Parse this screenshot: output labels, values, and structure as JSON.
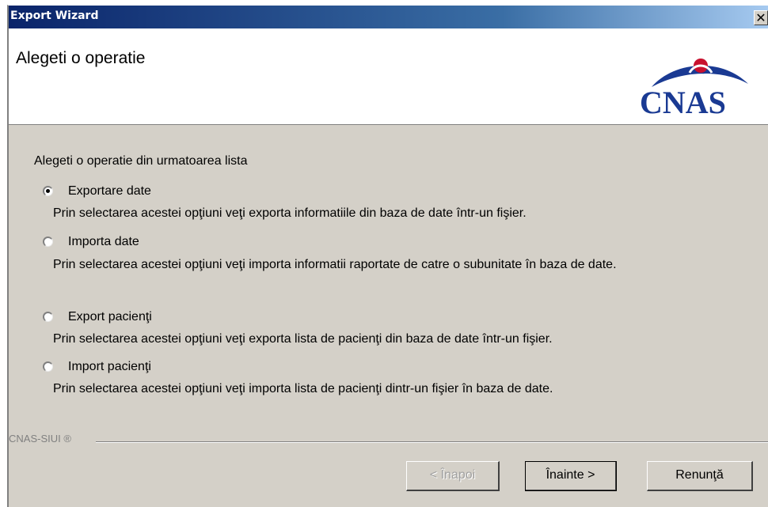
{
  "window": {
    "title": "Export Wizard",
    "close_glyph": "✕"
  },
  "header": {
    "title": "Alegeti o operatie",
    "logo_text": "CNAS"
  },
  "prompt": "Alegeti o operatie din urmatoarea lista",
  "options": [
    {
      "label": "Exportare date",
      "description": "Prin selectarea acestei opţiuni veţi exporta informatiile din baza de date într-un fişier.",
      "selected": true
    },
    {
      "label": "Importa date",
      "description": "Prin selectarea acestei opţiuni veţi importa informatii raportate de catre o subunitate în baza de date.",
      "selected": false
    },
    {
      "label": "Export pacienţi",
      "description": "Prin selectarea acestei opţiuni veţi exporta lista de pacienţi din baza de date într-un fişier.",
      "selected": false
    },
    {
      "label": "Import pacienţi",
      "description": "Prin selectarea acestei opţiuni veţi importa lista de pacienţi dintr-un fişier în baza de date.",
      "selected": false
    }
  ],
  "footer": {
    "label": "CNAS-SIUI ®"
  },
  "buttons": {
    "back": "< Înapoi",
    "next": "Înainte >",
    "cancel": "Renunţă"
  },
  "colors": {
    "logo_blue": "#1a3a93",
    "logo_red": "#c8102e",
    "title_bar": "#0a246a"
  }
}
